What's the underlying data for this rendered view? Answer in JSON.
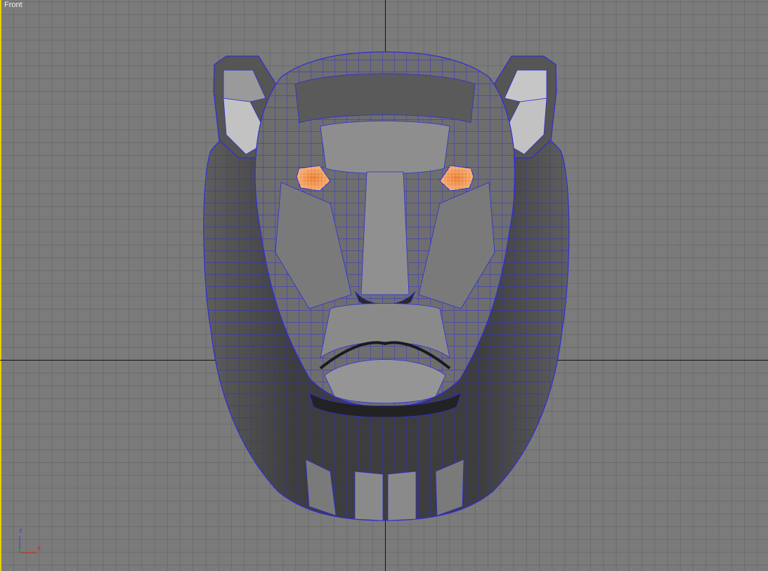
{
  "viewport": {
    "label": "Front",
    "background_color": "#7b7b7b",
    "active_border_color": "#e8d000",
    "wire_color": "#2d2ddb",
    "eye_color": "#f4a05a"
  },
  "axis_gizmo": {
    "z_label": "z",
    "y_label": "y",
    "x_label": "x",
    "z_color": "#3a3aff",
    "y_color": "#2fa82f",
    "x_color": "#e02020"
  },
  "scene_object": {
    "name": "lion-head-mesh",
    "display": "shaded-with-wireframe",
    "icon": "lion-head-icon"
  }
}
